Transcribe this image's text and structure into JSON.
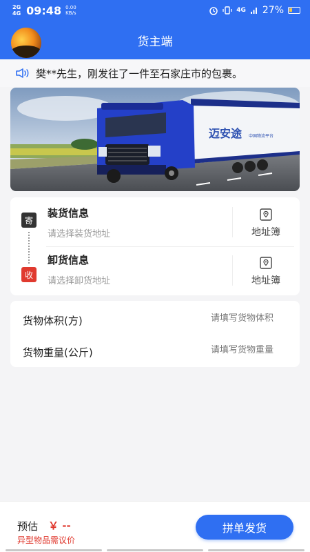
{
  "status_bar": {
    "network_1": "2G",
    "network_2": "4G",
    "time": "09:48",
    "speed_value": "0.00",
    "speed_unit": "KB/s",
    "signal": "4G",
    "battery": "27%"
  },
  "header": {
    "title": "货主端"
  },
  "notice": {
    "text": "樊**先生，刚发往了一件至石家庄市的包裹。"
  },
  "banner": {
    "truck_text": "迈安途",
    "truck_subtext": "中国物流平台"
  },
  "address": {
    "send_badge": "寄",
    "recv_badge": "收",
    "load_title": "装货信息",
    "load_placeholder": "请选择装货地址",
    "unload_title": "卸货信息",
    "unload_placeholder": "请选择卸货地址",
    "book_label": "地址簿"
  },
  "cargo": {
    "volume_label": "货物体积(方)",
    "volume_placeholder": "请填写货物体积",
    "weight_label": "货物重量(公斤)",
    "weight_placeholder": "请填写货物重量"
  },
  "footer": {
    "estimate_label": "预估",
    "estimate_value": "￥ --",
    "note": "异型物品需议价",
    "submit_label": "拼单发货"
  },
  "colors": {
    "primary": "#2f6ff2",
    "danger": "#e03a2f"
  }
}
